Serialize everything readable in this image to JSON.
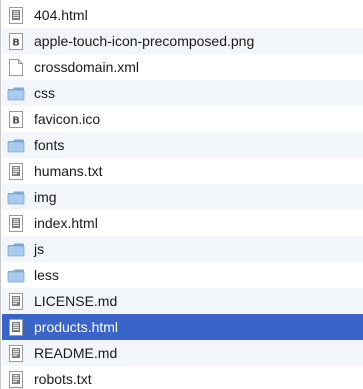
{
  "file_list": {
    "selected_index": 13,
    "items": [
      {
        "name": "404.html",
        "icon": "html-document-icon"
      },
      {
        "name": "apple-touch-icon-precomposed.png",
        "icon": "image-file-icon"
      },
      {
        "name": "crossdomain.xml",
        "icon": "blank-document-icon"
      },
      {
        "name": "css",
        "icon": "folder-icon"
      },
      {
        "name": "favicon.ico",
        "icon": "image-file-icon"
      },
      {
        "name": "fonts",
        "icon": "folder-icon"
      },
      {
        "name": "humans.txt",
        "icon": "text-document-icon"
      },
      {
        "name": "img",
        "icon": "folder-icon"
      },
      {
        "name": "index.html",
        "icon": "html-document-icon"
      },
      {
        "name": "js",
        "icon": "folder-icon"
      },
      {
        "name": "less",
        "icon": "folder-icon"
      },
      {
        "name": "LICENSE.md",
        "icon": "text-document-icon"
      },
      {
        "name": "products.html",
        "icon": "html-document-icon"
      },
      {
        "name": "README.md",
        "icon": "text-document-icon"
      },
      {
        "name": "robots.txt",
        "icon": "text-document-icon"
      }
    ]
  },
  "colors": {
    "selection": "#3a65c8",
    "alternate_row": "#f2f5f9",
    "folder": "#9fc3e6"
  }
}
